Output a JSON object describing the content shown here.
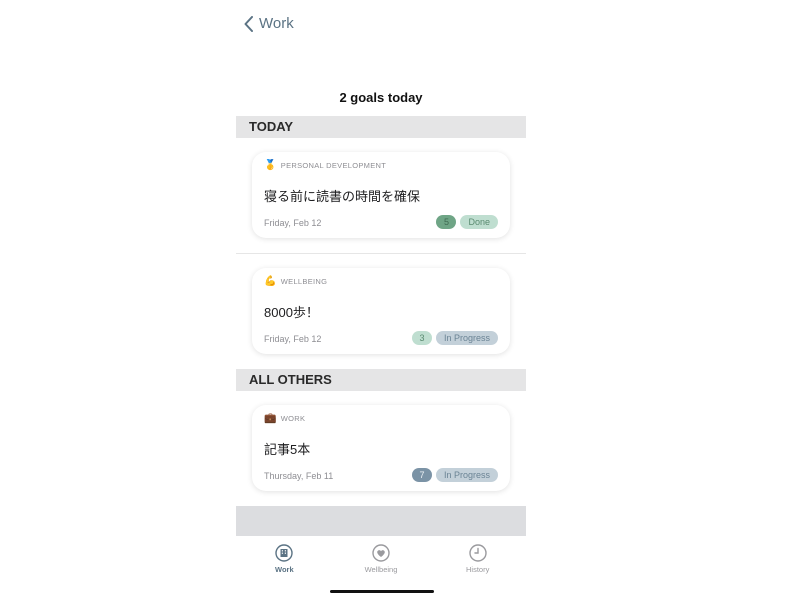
{
  "nav": {
    "back_label": "Work"
  },
  "summary": "2 goals today",
  "sections": [
    {
      "header": "TODAY",
      "cards": [
        {
          "category_icon": "medal",
          "category": "PERSONAL DEVELOPMENT",
          "title": "寝る前に読書の時間を確保",
          "date": "Friday, Feb 12",
          "count": "5",
          "status": "Done",
          "count_bg": "#6fa586",
          "count_fg": "#3f6b52",
          "status_bg": "#bfded0",
          "status_fg": "#5a8a70"
        },
        {
          "category_icon": "flexed-biceps",
          "category": "WELLBEING",
          "title": "8000歩！",
          "date": "Friday, Feb 12",
          "count": "3",
          "status": "In Progress",
          "count_bg": "#bfded0",
          "count_fg": "#5a8a70",
          "status_bg": "#c3d0d9",
          "status_fg": "#6b8495"
        }
      ]
    },
    {
      "header": "ALL OTHERS",
      "cards": [
        {
          "category_icon": "briefcase",
          "category": "WORK",
          "title": "記事5本",
          "date": "Thursday, Feb 11",
          "count": "7",
          "status": "In Progress",
          "count_bg": "#7b93a6",
          "count_fg": "#eef2f5",
          "status_bg": "#c3d0d9",
          "status_fg": "#6b8495"
        }
      ]
    }
  ],
  "tabs": [
    {
      "label": "Work",
      "icon": "building-icon",
      "active": true
    },
    {
      "label": "Wellbeing",
      "icon": "heart-icon",
      "active": false
    },
    {
      "label": "History",
      "icon": "clock-icon",
      "active": false
    }
  ],
  "colors": {
    "accent": "#5b7384",
    "section_header_bg": "#e5e5e6",
    "inactive_tab": "#9a9a9e"
  }
}
